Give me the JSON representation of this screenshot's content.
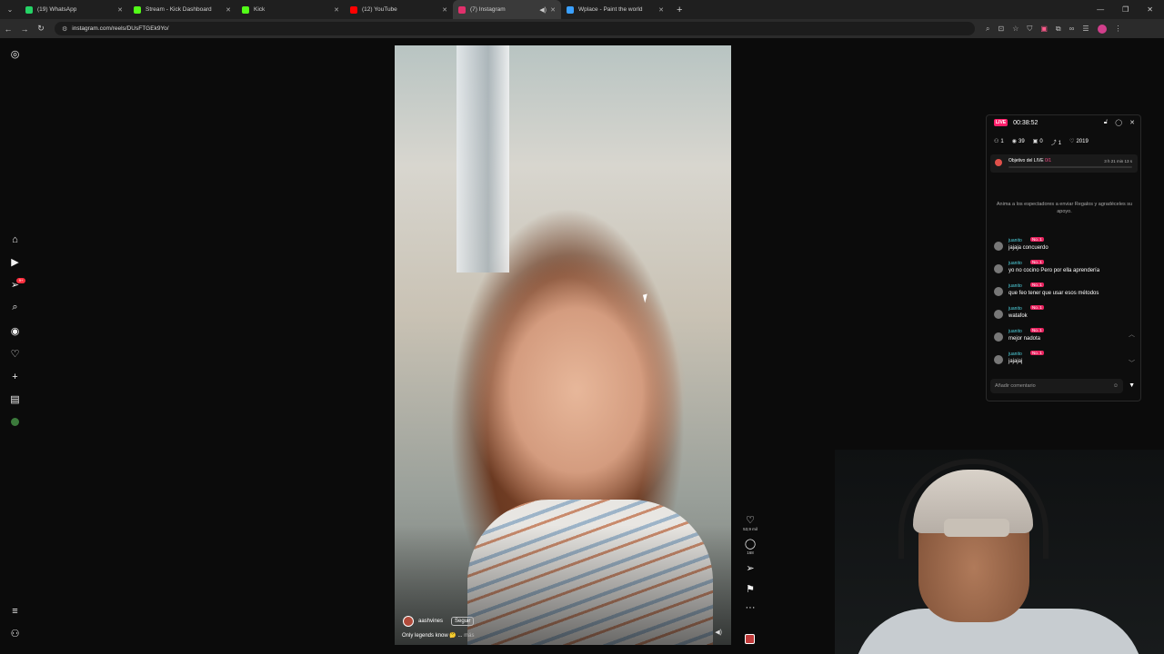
{
  "browser": {
    "tabs": [
      {
        "label": "(19) WhatsApp",
        "color": "#25d366",
        "active": false
      },
      {
        "label": "Stream - Kick Dashboard",
        "color": "#53fc18",
        "active": false
      },
      {
        "label": "Kick",
        "color": "#53fc18",
        "active": false
      },
      {
        "label": "(12) YouTube",
        "color": "#ff0000",
        "active": false
      },
      {
        "label": "(7) Instagram",
        "color": "#e1306c",
        "active": true
      },
      {
        "label": "Wplace - Paint the world",
        "color": "#3aa0ff",
        "active": false
      }
    ],
    "url": "instagram.com/reels/DUsFTGEk9Yo/"
  },
  "sidebar": {
    "notification_badge": "9+",
    "icons": [
      "instagram-icon",
      "home-icon",
      "reels-icon",
      "messages-icon",
      "search-icon",
      "explore-icon",
      "heart-icon",
      "create-icon",
      "dashboard-icon",
      "profile-icon",
      "menu-icon",
      "meta-icon"
    ]
  },
  "reel": {
    "author": "aashvines",
    "follow_label": "Seguir",
    "caption": "Only legends know 🤔 ...",
    "caption_more": "más",
    "likes": "53,9 mil",
    "comments": "168"
  },
  "live": {
    "badge": "LIVE",
    "timer": "00:38:52",
    "stats": {
      "guests": "1",
      "viewers": "39",
      "gifts": "0",
      "shares": "1",
      "likes": "2019"
    },
    "goal_label": "Objetivo del LIVE",
    "goal_progress": "0/1",
    "goal_time": "3 h 21 min 13 s",
    "invite_text": "Anima a los espectadores a enviar Regalos y agradéceles su apoyo.",
    "messages": [
      {
        "user": "juanito",
        "tag": "No. 1",
        "text": "jajaja concuerdo"
      },
      {
        "user": "juanito",
        "tag": "No. 1",
        "text": "yo no cocino Pero por ella aprendería"
      },
      {
        "user": "juanito",
        "tag": "No. 1",
        "text": "que feo tener que usar esos métodos"
      },
      {
        "user": "juanito",
        "tag": "No. 1",
        "text": "watafok"
      },
      {
        "user": "juanito",
        "tag": "No. 1",
        "text": "mejor nadota"
      },
      {
        "user": "juanito",
        "tag": "No. 1",
        "text": "jajajaj"
      }
    ],
    "comment_placeholder": "Añadir comentario"
  }
}
